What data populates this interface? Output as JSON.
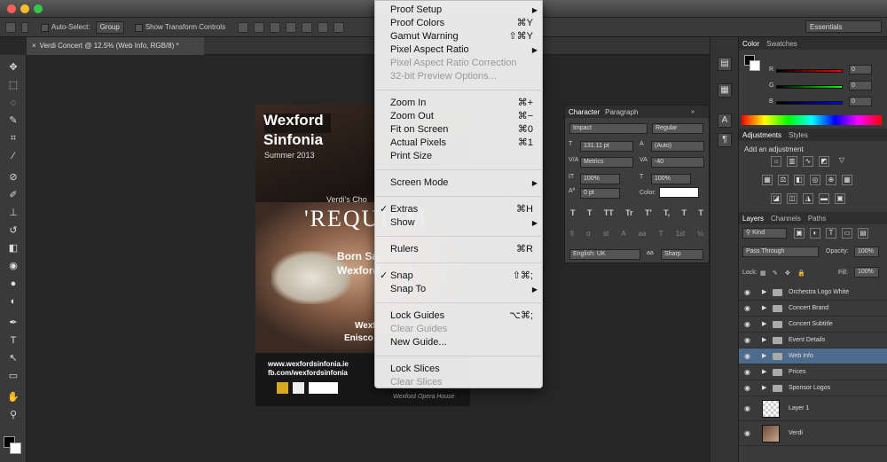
{
  "titlebar": {
    "traffic_colors": [
      "#fc5f57",
      "#fdbc2e",
      "#34c84a"
    ]
  },
  "options_bar": {
    "auto_select_label": "Auto-Select:",
    "auto_select_value": "Group",
    "show_transform_label": "Show Transform Controls",
    "workspace": "Essentials"
  },
  "document": {
    "tab_title": "Verdi Concert @ 12.5% (Web Info, RGB/8) *"
  },
  "poster": {
    "brand1": "Wexford",
    "brand2": "Sinfonia",
    "season": "Summer 2013",
    "choral": "Verdi's Cho",
    "requiem": "'REQUIEM",
    "born": "Born Sa",
    "wexford": "Wexford",
    "wexf2": "Wexf",
    "enis": "Enisco",
    "web": "www.wexfordsinfonia.ie",
    "fb": "fb.com/wexfordsinfonia",
    "venue": "Wexford Opera House"
  },
  "view_menu": {
    "items": [
      {
        "label": "Proof Setup",
        "shortcut": "",
        "submenu": true,
        "disabled": false,
        "checked": false
      },
      {
        "label": "Proof Colors",
        "shortcut": "⌘Y",
        "submenu": false,
        "disabled": false,
        "checked": false
      },
      {
        "label": "Gamut Warning",
        "shortcut": "⇧⌘Y",
        "submenu": false,
        "disabled": false,
        "checked": false
      },
      {
        "label": "Pixel Aspect Ratio",
        "shortcut": "",
        "submenu": true,
        "disabled": false,
        "checked": false
      },
      {
        "label": "Pixel Aspect Ratio Correction",
        "shortcut": "",
        "submenu": false,
        "disabled": true,
        "checked": false
      },
      {
        "label": "32-bit Preview Options...",
        "shortcut": "",
        "submenu": false,
        "disabled": true,
        "checked": false
      },
      {
        "label": "Zoom In",
        "shortcut": "⌘+",
        "submenu": false,
        "disabled": false,
        "checked": false
      },
      {
        "label": "Zoom Out",
        "shortcut": "⌘−",
        "submenu": false,
        "disabled": false,
        "checked": false
      },
      {
        "label": "Fit on Screen",
        "shortcut": "⌘0",
        "submenu": false,
        "disabled": false,
        "checked": false
      },
      {
        "label": "Actual Pixels",
        "shortcut": "⌘1",
        "submenu": false,
        "disabled": false,
        "checked": false
      },
      {
        "label": "Print Size",
        "shortcut": "",
        "submenu": false,
        "disabled": false,
        "checked": false
      },
      {
        "label": "Screen Mode",
        "shortcut": "",
        "submenu": true,
        "disabled": false,
        "checked": false
      },
      {
        "label": "Extras",
        "shortcut": "⌘H",
        "submenu": false,
        "disabled": false,
        "checked": true
      },
      {
        "label": "Show",
        "shortcut": "",
        "submenu": true,
        "disabled": false,
        "checked": false
      },
      {
        "label": "Rulers",
        "shortcut": "⌘R",
        "submenu": false,
        "disabled": false,
        "checked": false
      },
      {
        "label": "Snap",
        "shortcut": "⇧⌘;",
        "submenu": false,
        "disabled": false,
        "checked": true
      },
      {
        "label": "Snap To",
        "shortcut": "",
        "submenu": true,
        "disabled": false,
        "checked": false
      },
      {
        "label": "Lock Guides",
        "shortcut": "⌥⌘;",
        "submenu": false,
        "disabled": false,
        "checked": false
      },
      {
        "label": "Clear Guides",
        "shortcut": "",
        "submenu": false,
        "disabled": true,
        "checked": false
      },
      {
        "label": "New Guide...",
        "shortcut": "",
        "submenu": false,
        "disabled": false,
        "checked": false
      },
      {
        "label": "Lock Slices",
        "shortcut": "",
        "submenu": false,
        "disabled": false,
        "checked": false
      },
      {
        "label": "Clear Slices",
        "shortcut": "",
        "submenu": false,
        "disabled": true,
        "checked": false
      }
    ]
  },
  "character_panel": {
    "tab1": "Character",
    "tab2": "Paragraph",
    "font": "Impact",
    "style": "Regular",
    "size": "131.11 pt",
    "leading": "(Auto)",
    "kerning": "Metrics",
    "tracking": "-40",
    "vscale": "100%",
    "hscale": "100%",
    "baseline": "0 pt",
    "color_label": "Color:",
    "type_buttons": [
      "T",
      "T",
      "TT",
      "Tr",
      "T'",
      "T,",
      "T",
      "T"
    ],
    "language": "English: UK",
    "antialias": "Sharp"
  },
  "color_panel": {
    "tab1": "Color",
    "tab2": "Swatches",
    "r_label": "R",
    "g_label": "G",
    "b_label": "B",
    "r": "0",
    "g": "0",
    "b": "0"
  },
  "adjustments_panel": {
    "tab1": "Adjustments",
    "tab2": "Styles",
    "heading": "Add an adjustment"
  },
  "layers_panel": {
    "tab1": "Layers",
    "tab2": "Channels",
    "tab3": "Paths",
    "kind": "Kind",
    "blend": "Pass Through",
    "opacity_label": "Opacity:",
    "opacity": "100%",
    "lock_label": "Lock:",
    "fill_label": "Fill:",
    "fill": "100%",
    "layers": [
      {
        "name": "Orchestra Logo White",
        "group": true
      },
      {
        "name": "Concert Brand",
        "group": true
      },
      {
        "name": "Concert Subtitle",
        "group": true
      },
      {
        "name": "Event Details",
        "group": true
      },
      {
        "name": "Web Info",
        "group": true,
        "selected": true
      },
      {
        "name": "Prices",
        "group": true
      },
      {
        "name": "Sponsor Logos",
        "group": true
      },
      {
        "name": "Layer 1",
        "group": false
      },
      {
        "name": "Verdi",
        "group": false
      }
    ]
  }
}
